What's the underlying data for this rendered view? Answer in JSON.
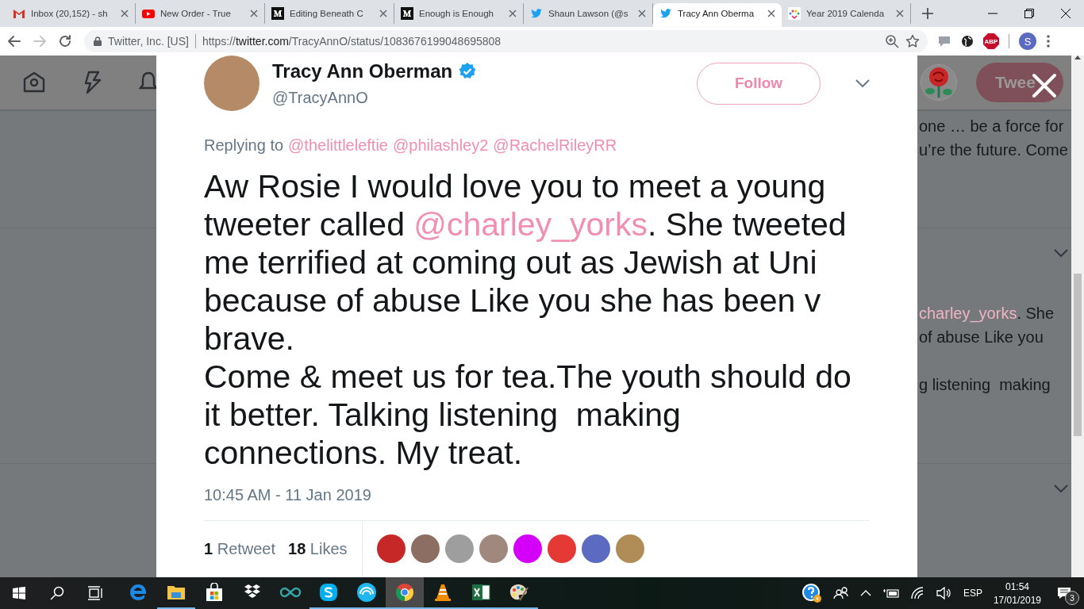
{
  "browser": {
    "tabs": [
      {
        "kind": "gmail",
        "title": "Inbox (20,152) - sh",
        "selected": false
      },
      {
        "kind": "youtube",
        "title": "New Order - True",
        "selected": false
      },
      {
        "kind": "medium",
        "title": "Editing Beneath C",
        "selected": false
      },
      {
        "kind": "medium",
        "title": "Enough is Enough",
        "selected": false
      },
      {
        "kind": "twitter",
        "title": "Shaun Lawson (@s",
        "selected": false
      },
      {
        "kind": "twitter",
        "title": "Tracy Ann Oberma",
        "selected": true
      },
      {
        "kind": "calendar",
        "title": "Year 2019 Calenda",
        "selected": false
      }
    ],
    "forward_disabled": true,
    "site_identity": "Twitter, Inc. [US]",
    "url": {
      "scheme": "https://",
      "host": "twitter.com",
      "path": "/TracyAnnO/status/1083676199048695808"
    },
    "extension_label": "ABP",
    "profile_initial": "S"
  },
  "backdrop": {
    "tweet_button": "Twee",
    "first_tweet_lines": [
      [
        {
          "kind": "text",
          "text": "one … be a force for"
        }
      ],
      [
        {
          "kind": "text",
          "text": "u’re the future. Come"
        }
      ]
    ],
    "second_tweet_lines": [
      [
        {
          "kind": "mention",
          "text": "charley_yorks"
        },
        {
          "kind": "text",
          "text": ". She"
        }
      ],
      [
        {
          "kind": "text",
          "text": "of abuse Like you"
        }
      ],
      [
        {
          "kind": "text",
          "text": "g listening  making"
        }
      ]
    ]
  },
  "tweet": {
    "name": "Tracy Ann Oberman",
    "verified": true,
    "handle": "@TracyAnnO",
    "follow_button": "Follow",
    "replying_label": "Replying to",
    "reply_mentions": [
      "@thelittleleftie",
      "@philashley2",
      "@RachelRileyRR"
    ],
    "paragraphs": [
      [
        {
          "kind": "text",
          "text": "Aw Rosie I would love you to meet a young tweeter called "
        },
        {
          "kind": "mention",
          "text": "@charley_yorks"
        },
        {
          "kind": "text",
          "text": ". She tweeted me terrified at coming out as Jewish at Uni because of abuse Like you she has been v brave."
        }
      ],
      [
        {
          "kind": "text",
          "text": "Come & meet us for tea.The youth should do it better. Talking listening  making connections. My treat."
        }
      ]
    ],
    "timestamp": "10:45 AM - 11 Jan 2019",
    "stats": [
      {
        "count": "1",
        "label": "Retweet"
      },
      {
        "count": "18",
        "label": "Likes"
      }
    ]
  },
  "taskbar": {
    "apps": [
      {
        "kind": "edge",
        "running": false,
        "selected": false
      },
      {
        "kind": "explorer",
        "running": true,
        "selected": false
      },
      {
        "kind": "store",
        "running": false,
        "selected": false
      },
      {
        "kind": "dropbox",
        "running": false,
        "selected": false
      },
      {
        "kind": "infinity",
        "running": false,
        "selected": false
      },
      {
        "kind": "skype",
        "running": true,
        "selected": false
      },
      {
        "kind": "signal",
        "running": true,
        "selected": false
      },
      {
        "kind": "chrome",
        "running": true,
        "selected": true
      },
      {
        "kind": "vlc",
        "running": true,
        "selected": false
      },
      {
        "kind": "excel",
        "running": true,
        "selected": false
      },
      {
        "kind": "paint",
        "running": true,
        "selected": false
      }
    ],
    "language": "ESP",
    "time": "01:54",
    "date": "17/01/2019",
    "notification_count": "3"
  }
}
